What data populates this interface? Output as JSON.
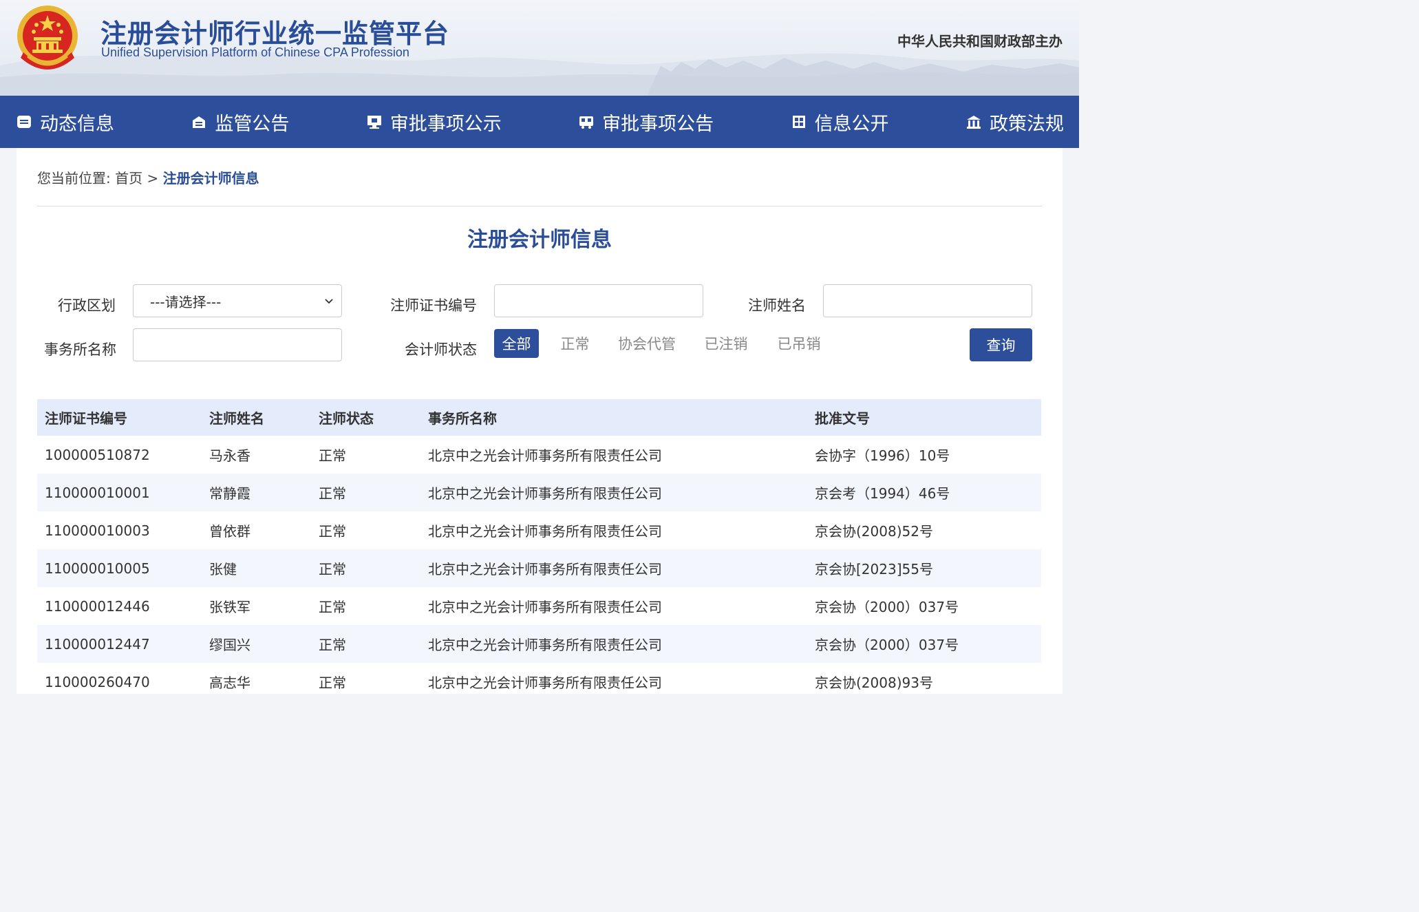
{
  "header": {
    "title": "注册会计师行业统一监管平台",
    "subtitle": "Unified Supervision Platform of Chinese CPA Profession",
    "sponsor": "中华人民共和国财政部主办"
  },
  "nav": [
    {
      "label": "动态信息",
      "icon": "news-icon"
    },
    {
      "label": "监管公告",
      "icon": "announcement-icon"
    },
    {
      "label": "审批事项公示",
      "icon": "monitor-icon"
    },
    {
      "label": "审批事项公告",
      "icon": "bus-icon"
    },
    {
      "label": "信息公开",
      "icon": "info-grid-icon"
    },
    {
      "label": "政策法规",
      "icon": "bank-icon"
    }
  ],
  "breadcrumb": {
    "prefix": "您当前位置: ",
    "home": "首页",
    "separator": " > ",
    "current": "注册会计师信息"
  },
  "page_title": "注册会计师信息",
  "filters": {
    "region_label": "行政区划",
    "region_value": "---请选择---",
    "cert_label": "注师证书编号",
    "cert_value": "",
    "name_label": "注师姓名",
    "name_value": "",
    "firm_label": "事务所名称",
    "firm_value": "",
    "status_label": "会计师状态",
    "status_options": [
      "全部",
      "正常",
      "协会代管",
      "已注销",
      "已吊销"
    ],
    "status_selected": "全部",
    "query_label": "查询"
  },
  "table": {
    "headers": [
      "注师证书编号",
      "注师姓名",
      "注师状态",
      "事务所名称",
      "批准文号"
    ],
    "rows": [
      [
        "100000510872",
        "马永香",
        "正常",
        "北京中之光会计师事务所有限责任公司",
        "会协字（1996）10号"
      ],
      [
        "110000010001",
        "常静霞",
        "正常",
        "北京中之光会计师事务所有限责任公司",
        "京会考（1994）46号"
      ],
      [
        "110000010003",
        "曾依群",
        "正常",
        "北京中之光会计师事务所有限责任公司",
        "京会协(2008)52号"
      ],
      [
        "110000010005",
        "张健",
        "正常",
        "北京中之光会计师事务所有限责任公司",
        "京会协[2023]55号"
      ],
      [
        "110000012446",
        "张铁军",
        "正常",
        "北京中之光会计师事务所有限责任公司",
        "京会协（2000）037号"
      ],
      [
        "110000012447",
        "缪国兴",
        "正常",
        "北京中之光会计师事务所有限责任公司",
        "京会协（2000）037号"
      ],
      [
        "110000260470",
        "高志华",
        "正常",
        "北京中之光会计师事务所有限责任公司",
        "京会协(2008)93号"
      ]
    ]
  },
  "colors": {
    "primary": "#2d4e9a",
    "title_blue": "#2a4d97",
    "header_row_bg": "#e4ebfa",
    "alt_row_bg": "#f3f6fd"
  }
}
